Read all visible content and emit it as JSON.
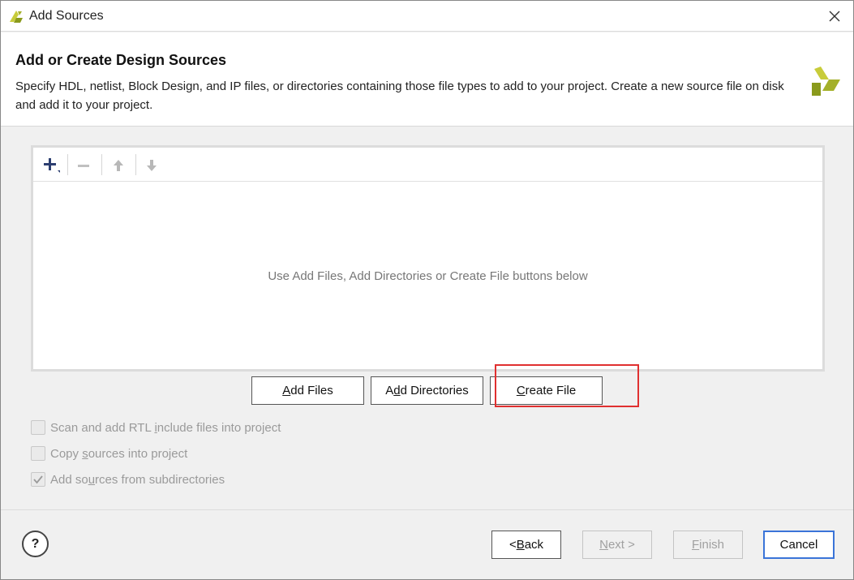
{
  "window": {
    "title": "Add Sources",
    "icons": {
      "app": "vivado-icon",
      "close": "close-icon"
    }
  },
  "header": {
    "title": "Add or Create Design Sources",
    "description": "Specify HDL, netlist, Block Design, and IP files, or directories containing those file types to add to your project. Create a new source file on disk and add it to your project."
  },
  "toolbar": {
    "icons": [
      "add-icon",
      "remove-icon",
      "move-up-icon",
      "move-down-icon"
    ]
  },
  "file_list": {
    "empty_message": "Use Add Files, Add Directories or Create File buttons below"
  },
  "buttons": {
    "add_files": {
      "mnemonic": "A",
      "rest": "dd Files"
    },
    "add_directories": {
      "pre": "A",
      "mnemonic": "d",
      "rest": "d Directories"
    },
    "create_file": {
      "mnemonic": "C",
      "rest": "reate File"
    }
  },
  "options": {
    "scan_rtl": {
      "pre": "Scan and add RTL ",
      "mnemonic": "i",
      "post": "nclude files into project",
      "checked": false,
      "enabled": false
    },
    "copy_sources": {
      "pre": "Copy ",
      "mnemonic": "s",
      "post": "ources into project",
      "checked": false,
      "enabled": false
    },
    "add_subdirs": {
      "pre": "Add so",
      "mnemonic": "u",
      "post": "rces from subdirectories",
      "checked": true,
      "enabled": false
    }
  },
  "footer": {
    "help_label": "?",
    "back": {
      "pre": "< ",
      "mnemonic": "B",
      "rest": "ack"
    },
    "next": {
      "mnemonic": "N",
      "rest": "ext >"
    },
    "finish": {
      "mnemonic": "F",
      "rest": "inish"
    },
    "cancel_label": "Cancel"
  },
  "colors": {
    "highlight": "#e03030",
    "primary_border": "#3a74d8",
    "logo_light": "#c8cc3a",
    "logo_dark": "#8a9a1c"
  }
}
